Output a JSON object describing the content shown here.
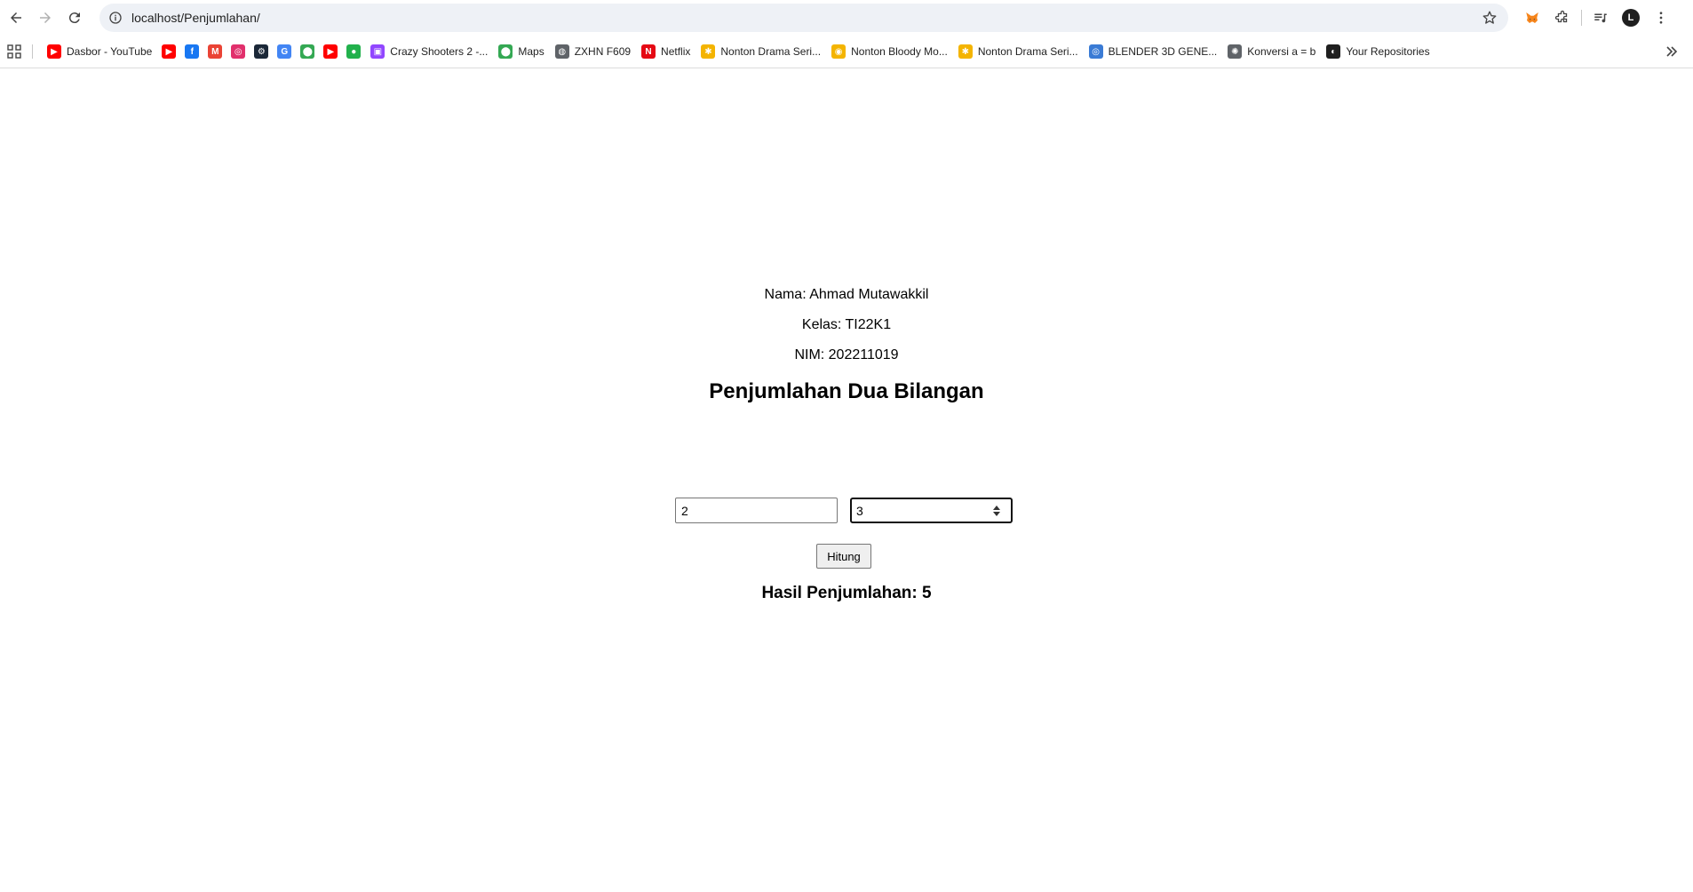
{
  "browser": {
    "url": "localhost/Penjumlahan/",
    "profile_initial": "L"
  },
  "bookmarks": [
    {
      "label": "Dasbor - YouTube",
      "icon": "youtube-icon",
      "color": "#ff0000"
    },
    {
      "label": "",
      "icon": "youtube-icon",
      "color": "#ff0000"
    },
    {
      "label": "",
      "icon": "facebook-icon",
      "color": "#1877f2"
    },
    {
      "label": "",
      "icon": "gmail-icon",
      "color": "#ea4335"
    },
    {
      "label": "",
      "icon": "instagram-icon",
      "color": "#e1306c"
    },
    {
      "label": "",
      "icon": "steam-icon",
      "color": "#1b2838"
    },
    {
      "label": "",
      "icon": "google-icon",
      "color": "#4285f4"
    },
    {
      "label": "",
      "icon": "google-maps-icon",
      "color": "#34a853"
    },
    {
      "label": "",
      "icon": "youtube-icon",
      "color": "#ff0000"
    },
    {
      "label": "",
      "icon": "app-icon",
      "color": "#22b14c"
    },
    {
      "label": "Crazy Shooters 2 -...",
      "icon": "twitch-icon",
      "color": "#9146ff"
    },
    {
      "label": "Maps",
      "icon": "google-maps-icon",
      "color": "#34a853"
    },
    {
      "label": "ZXHN F609",
      "icon": "globe-icon",
      "color": "#5f6368"
    },
    {
      "label": "Netflix",
      "icon": "netflix-icon",
      "color": "#e50914"
    },
    {
      "label": "Nonton Drama Seri...",
      "icon": "pinwheel-icon",
      "color": "#f4b400"
    },
    {
      "label": "Nonton Bloody Mo...",
      "icon": "film-icon",
      "color": "#f4b400"
    },
    {
      "label": "Nonton Drama Seri...",
      "icon": "pinwheel-icon",
      "color": "#f4b400"
    },
    {
      "label": "BLENDER 3D GENE...",
      "icon": "blender-icon",
      "color": "#3a7bd5"
    },
    {
      "label": "Konversi a = b",
      "icon": "gear-icon",
      "color": "#5f6368"
    },
    {
      "label": "Your Repositories",
      "icon": "github-icon",
      "color": "#1f1f1f"
    }
  ],
  "page": {
    "nama": "Nama: Ahmad Mutawakkil",
    "kelas": "Kelas: TI22K1",
    "nim": "NIM: 202211019",
    "heading": "Penjumlahan Dua Bilangan",
    "input_a": "2",
    "input_b": "3",
    "button_label": "Hitung",
    "result": "Hasil Penjumlahan: 5"
  }
}
